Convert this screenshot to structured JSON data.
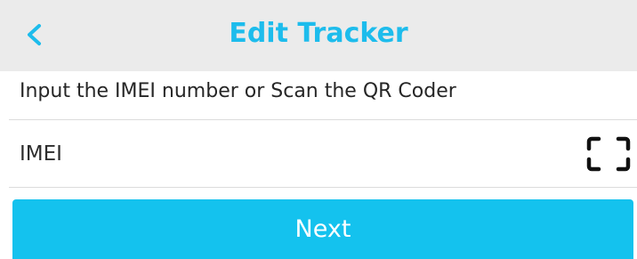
{
  "colors": {
    "accent": "#1dbcec",
    "header_bg": "#ebebeb",
    "button_bg": "#14c2ee",
    "text": "#262626",
    "button_text": "#ffffff"
  },
  "header": {
    "title": "Edit Tracker",
    "back_icon": "chevron-left-icon"
  },
  "instruction": "Input the IMEI number or Scan the QR Coder",
  "imei_field": {
    "value": "",
    "placeholder": "IMEI",
    "scan_icon": "scan-frame-icon"
  },
  "next_button": {
    "label": "Next"
  }
}
